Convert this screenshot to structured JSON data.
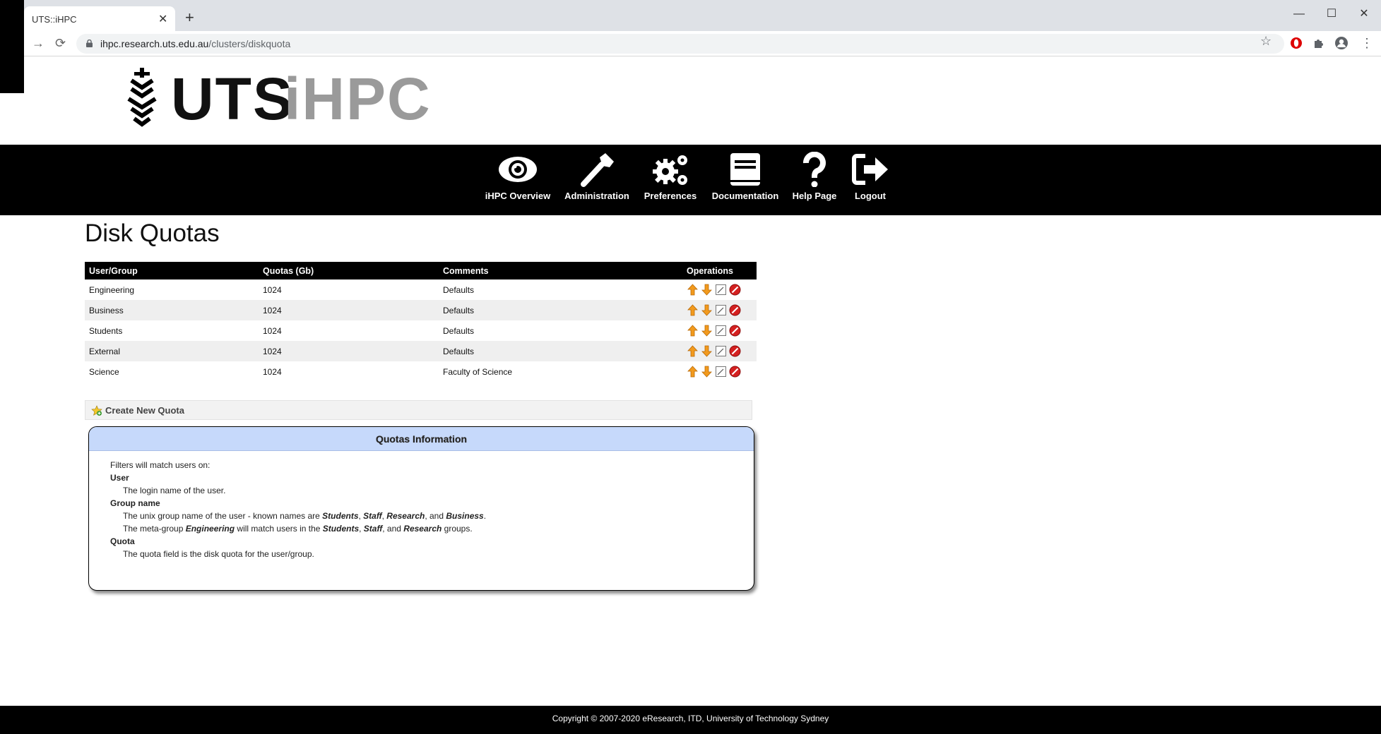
{
  "browser": {
    "tab_title": "UTS::iHPC",
    "url_host": "ihpc.research.uts.edu.au",
    "url_path": "/clusters/diskquota"
  },
  "logo": {
    "uts": "UTS",
    "ihpc": "iHPC"
  },
  "nav": {
    "items": [
      {
        "label": "iHPC Overview",
        "icon": "eye-icon"
      },
      {
        "label": "Administration",
        "icon": "wrench-icon"
      },
      {
        "label": "Preferences",
        "icon": "gears-icon"
      },
      {
        "label": "Documentation",
        "icon": "book-icon"
      },
      {
        "label": "Help Page",
        "icon": "question-icon"
      },
      {
        "label": "Logout",
        "icon": "logout-icon"
      }
    ]
  },
  "page": {
    "title": "Disk Quotas"
  },
  "table": {
    "headers": [
      "User/Group",
      "Quotas (Gb)",
      "Comments",
      "Operations"
    ],
    "rows": [
      {
        "name": "Engineering",
        "quota": "1024",
        "comment": "Defaults"
      },
      {
        "name": "Business",
        "quota": "1024",
        "comment": "Defaults"
      },
      {
        "name": "Students",
        "quota": "1024",
        "comment": "Defaults"
      },
      {
        "name": "External",
        "quota": "1024",
        "comment": "Defaults"
      },
      {
        "name": "Science",
        "quota": "1024",
        "comment": "Faculty of Science"
      }
    ]
  },
  "create": {
    "label": "Create New Quota"
  },
  "info": {
    "title": "Quotas Information",
    "intro": "Filters will match users on:",
    "user_term": "User",
    "user_def": "The login name of the user.",
    "group_term": "Group name",
    "group_def1_a": "The unix group name of the user - known names are ",
    "group_def1_students": "Students",
    "group_def1_sep1": ", ",
    "group_def1_staff": "Staff",
    "group_def1_sep2": ", ",
    "group_def1_research": "Research",
    "group_def1_and": ", and ",
    "group_def1_business": "Business",
    "group_def1_end": ".",
    "group_def2_a": "The meta-group ",
    "group_def2_engineering": "Engineering",
    "group_def2_b": " will match users in the ",
    "group_def2_students": "Students",
    "group_def2_sep": ", ",
    "group_def2_staff": "Staff",
    "group_def2_and": ", and ",
    "group_def2_research": "Research",
    "group_def2_end": " groups.",
    "quota_term": "Quota",
    "quota_def": "The quota field is the disk quota for the user/group."
  },
  "footer": {
    "text": "Copyright © 2007-2020 eResearch, ITD, University of Technology Sydney"
  }
}
